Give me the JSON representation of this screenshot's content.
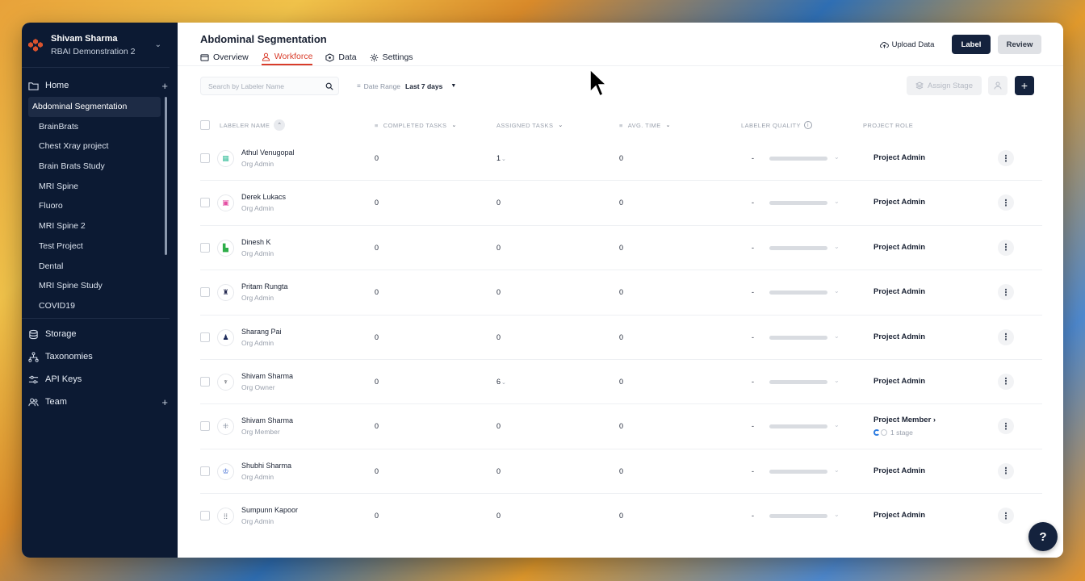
{
  "sidebar": {
    "user_name": "Shivam Sharma",
    "workspace": "RBAI Demonstration 2",
    "home_label": "Home",
    "projects": [
      {
        "label": "Abdominal Segmentation",
        "active": true
      },
      {
        "label": "BrainBrats",
        "active": false
      },
      {
        "label": "Chest Xray project",
        "active": false
      },
      {
        "label": "Brain Brats Study",
        "active": false
      },
      {
        "label": "MRI Spine",
        "active": false
      },
      {
        "label": "Fluoro",
        "active": false
      },
      {
        "label": "MRI Spine 2",
        "active": false
      },
      {
        "label": "Test Project",
        "active": false
      },
      {
        "label": "Dental",
        "active": false
      },
      {
        "label": "MRI Spine Study",
        "active": false
      },
      {
        "label": "COVID19",
        "active": false
      }
    ],
    "storage_label": "Storage",
    "taxonomies_label": "Taxonomies",
    "apikeys_label": "API Keys",
    "team_label": "Team"
  },
  "header": {
    "title": "Abdominal Segmentation",
    "tabs": [
      {
        "label": "Overview",
        "icon": "folder-icon"
      },
      {
        "label": "Workforce",
        "icon": "user-icon"
      },
      {
        "label": "Data",
        "icon": "data-icon"
      },
      {
        "label": "Settings",
        "icon": "gear-icon"
      }
    ],
    "active_tab": "Workforce",
    "upload_label": "Upload Data",
    "label_button": "Label",
    "review_button": "Review"
  },
  "toolbar": {
    "search_placeholder": "Search by Labeler Name",
    "date_range_label": "Date Range",
    "date_range_value": "Last 7 days",
    "assign_stage_label": "Assign Stage",
    "add_label": "+"
  },
  "table": {
    "headers": {
      "labeler_name": "LABELER NAME",
      "completed": "COMPLETED TASKS",
      "assigned": "ASSIGNED TASKS",
      "avg_time": "AVG. TIME",
      "quality": "LABELER QUALITY",
      "role": "PROJECT ROLE"
    },
    "rows": [
      {
        "name": "Athul Venugopal",
        "org_role": "Org Admin",
        "avatar": "▦",
        "avatar_color": "#3bbf9c",
        "completed": "0",
        "assigned": "1",
        "assigned_expand": true,
        "avg_time": "0",
        "quality": "-",
        "project_role": "Project Admin",
        "stage": ""
      },
      {
        "name": "Derek Lukacs",
        "org_role": "Org Admin",
        "avatar": "▣",
        "avatar_color": "#e44fa3",
        "completed": "0",
        "assigned": "0",
        "assigned_expand": false,
        "avg_time": "0",
        "quality": "-",
        "project_role": "Project Admin",
        "stage": ""
      },
      {
        "name": "Dinesh K",
        "org_role": "Org Admin",
        "avatar": "▙",
        "avatar_color": "#2fae4a",
        "completed": "0",
        "assigned": "0",
        "assigned_expand": false,
        "avg_time": "0",
        "quality": "-",
        "project_role": "Project Admin",
        "stage": ""
      },
      {
        "name": "Pritam Rungta",
        "org_role": "Org Admin",
        "avatar": "♜",
        "avatar_color": "#2a2f55",
        "completed": "0",
        "assigned": "0",
        "assigned_expand": false,
        "avg_time": "0",
        "quality": "-",
        "project_role": "Project Admin",
        "stage": ""
      },
      {
        "name": "Sharang Pai",
        "org_role": "Org Admin",
        "avatar": "♟",
        "avatar_color": "#1c2a5a",
        "completed": "0",
        "assigned": "0",
        "assigned_expand": false,
        "avg_time": "0",
        "quality": "-",
        "project_role": "Project Admin",
        "stage": ""
      },
      {
        "name": "Shivam Sharma",
        "org_role": "Org Owner",
        "avatar": "♆",
        "avatar_color": "#2a2f3a",
        "completed": "0",
        "assigned": "6",
        "assigned_expand": true,
        "avg_time": "0",
        "quality": "-",
        "project_role": "Project Admin",
        "stage": ""
      },
      {
        "name": "Shivam Sharma",
        "org_role": "Org Member",
        "avatar": "⁜",
        "avatar_color": "#8a93a3",
        "completed": "0",
        "assigned": "0",
        "assigned_expand": false,
        "avg_time": "0",
        "quality": "-",
        "project_role": "Project Member",
        "stage": "1 stage"
      },
      {
        "name": "Shubhi Sharma",
        "org_role": "Org Admin",
        "avatar": "♔",
        "avatar_color": "#2f5fd0",
        "completed": "0",
        "assigned": "0",
        "assigned_expand": false,
        "avg_time": "0",
        "quality": "-",
        "project_role": "Project Admin",
        "stage": ""
      },
      {
        "name": "Sumpunn Kapoor",
        "org_role": "Org Admin",
        "avatar": "⁞⁞",
        "avatar_color": "#5c6473",
        "completed": "0",
        "assigned": "0",
        "assigned_expand": false,
        "avg_time": "0",
        "quality": "-",
        "project_role": "Project Admin",
        "stage": ""
      }
    ]
  },
  "help_label": "?",
  "colors": {
    "sidebar_bg": "#0c1a33",
    "accent_red": "#d93c2a",
    "primary_navy": "#14223d"
  }
}
